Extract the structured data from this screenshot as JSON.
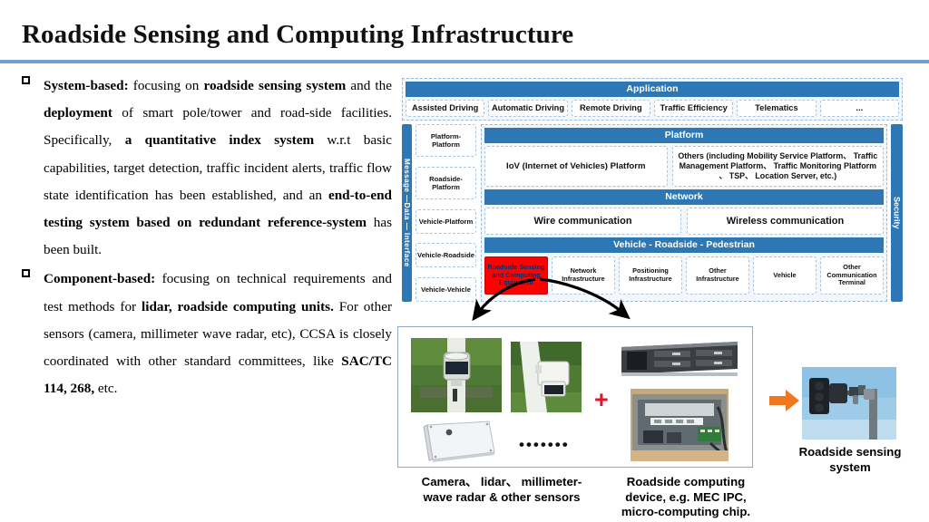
{
  "slide": {
    "title": "Roadside Sensing and Computing Infrastructure",
    "accent_blue": "#2E77B5",
    "rule_blue": "#6F9FD0",
    "highlight_red": "#FF0000",
    "arrow_orange": "#F07820"
  },
  "bullets": [
    {
      "marker": "square-outline",
      "segments": [
        {
          "text": "System-based:",
          "bold": true
        },
        {
          "text": " focusing on ",
          "bold": false
        },
        {
          "text": "roadside sensing system",
          "bold": true
        },
        {
          "text": " and the ",
          "bold": false
        },
        {
          "text": "deployment",
          "bold": true
        },
        {
          "text": " of smart pole/tower and road-side facilities. Specifically, ",
          "bold": false
        },
        {
          "text": "a quantitative index system",
          "bold": true
        },
        {
          "text": " w.r.t basic capabilities, target detection, traffic incident alerts, traffic flow state identification has been established, and an ",
          "bold": false
        },
        {
          "text": "end-to-end testing system based on redundant reference-system",
          "bold": true
        },
        {
          "text": " has been built.",
          "bold": false
        }
      ]
    },
    {
      "marker": "square-outline",
      "segments": [
        {
          "text": "Component-based:",
          "bold": true
        },
        {
          "text": " focusing on technical requirements and test methods for ",
          "bold": false
        },
        {
          "text": "lidar, roadside computing units.",
          "bold": true
        },
        {
          "text": " For other sensors (camera, millimeter wave radar, etc), CCSA is closely coordinated with other standard committees, like ",
          "bold": false
        },
        {
          "text": "SAC/TC 114, 268,",
          "bold": true
        },
        {
          "text": " etc.",
          "bold": false
        }
      ]
    }
  ],
  "architecture": {
    "application": {
      "band_label": "Application",
      "items": [
        "Assisted Driving",
        "Automatic Driving",
        "Remote Driving",
        "Traffic Efficiency",
        "Telematics",
        "..."
      ]
    },
    "left_rail_label": "Message —Data — Interface",
    "right_rail_label": "Security",
    "message_items": [
      "Platform-Platform",
      "Roadside-Platform",
      "Vehicle-Platform",
      "Vehicle-Roadside",
      "Vehicle-Vehicle"
    ],
    "platform": {
      "band_label": "Platform",
      "iov": "IoV  (Internet of Vehicles) Platform",
      "others": "Others  (including Mobility Service Platform、 Traffic Management Platform、  Traffic Monitoring Platform 、 TSP、 Location Server, etc.)"
    },
    "network": {
      "band_label": "Network",
      "items": [
        "Wire communication",
        "Wireless communication"
      ]
    },
    "vrp": {
      "band_label": "Vehicle - Roadside - Pedestrian",
      "items": [
        {
          "label": "Roadside Sensing and Computing Equipment",
          "highlighted": true
        },
        {
          "label": "Network Infrastructure",
          "highlighted": false
        },
        {
          "label": "Positioning Infrastructure",
          "highlighted": false
        },
        {
          "label": "Other Infrastructure",
          "highlighted": false
        },
        {
          "label": "Vehicle",
          "highlighted": false
        },
        {
          "label": "Other Communication Terminal",
          "highlighted": false
        }
      ]
    }
  },
  "photo_panel": {
    "photos": [
      {
        "name": "lidar-on-pole-photo",
        "alt": "lidar mounted on white pole in grass"
      },
      {
        "name": "camera-on-pole-photo",
        "alt": "white box camera mounted on pole"
      },
      {
        "name": "radar-panel-photo",
        "alt": "white flat millimeter-wave radar panel"
      },
      {
        "name": "rack-server-photo",
        "alt": "black 2U rack mount server"
      },
      {
        "name": "edge-computing-box-photo",
        "alt": "opened roadside computing cabinet with boards and cables"
      }
    ],
    "plus_symbol": "+",
    "ellipsis": "•••••••",
    "caption_left": "Camera、 lidar、 millimeter-wave radar & other sensors",
    "caption_right": "Roadside computing device, e.g. MEC IPC, micro-computing chip."
  },
  "result": {
    "arrow": "right-arrow",
    "photo": {
      "name": "roadside-sensing-system-photo",
      "alt": "traffic signal pole with mounted sensors against blue sky"
    },
    "caption": "Roadside sensing system"
  }
}
